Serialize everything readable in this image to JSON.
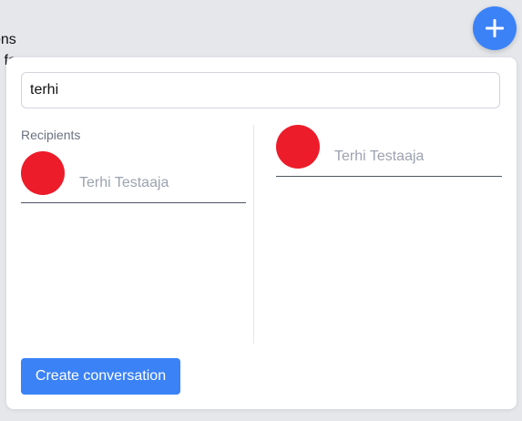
{
  "background": {
    "line1": "ons",
    "line2": "s fo"
  },
  "fab": {
    "icon": "plus-icon",
    "color": "#3b82f6"
  },
  "dialog": {
    "search": {
      "value": "terhi",
      "placeholder": ""
    },
    "recipients": {
      "heading": "Recipients",
      "items": [
        {
          "name": "Terhi Testaaja",
          "avatar_color": "#ed1c2a"
        }
      ]
    },
    "results": {
      "items": [
        {
          "name": "Terhi Testaaja",
          "avatar_color": "#ed1c2a"
        }
      ]
    },
    "create_button_label": "Create conversation"
  }
}
